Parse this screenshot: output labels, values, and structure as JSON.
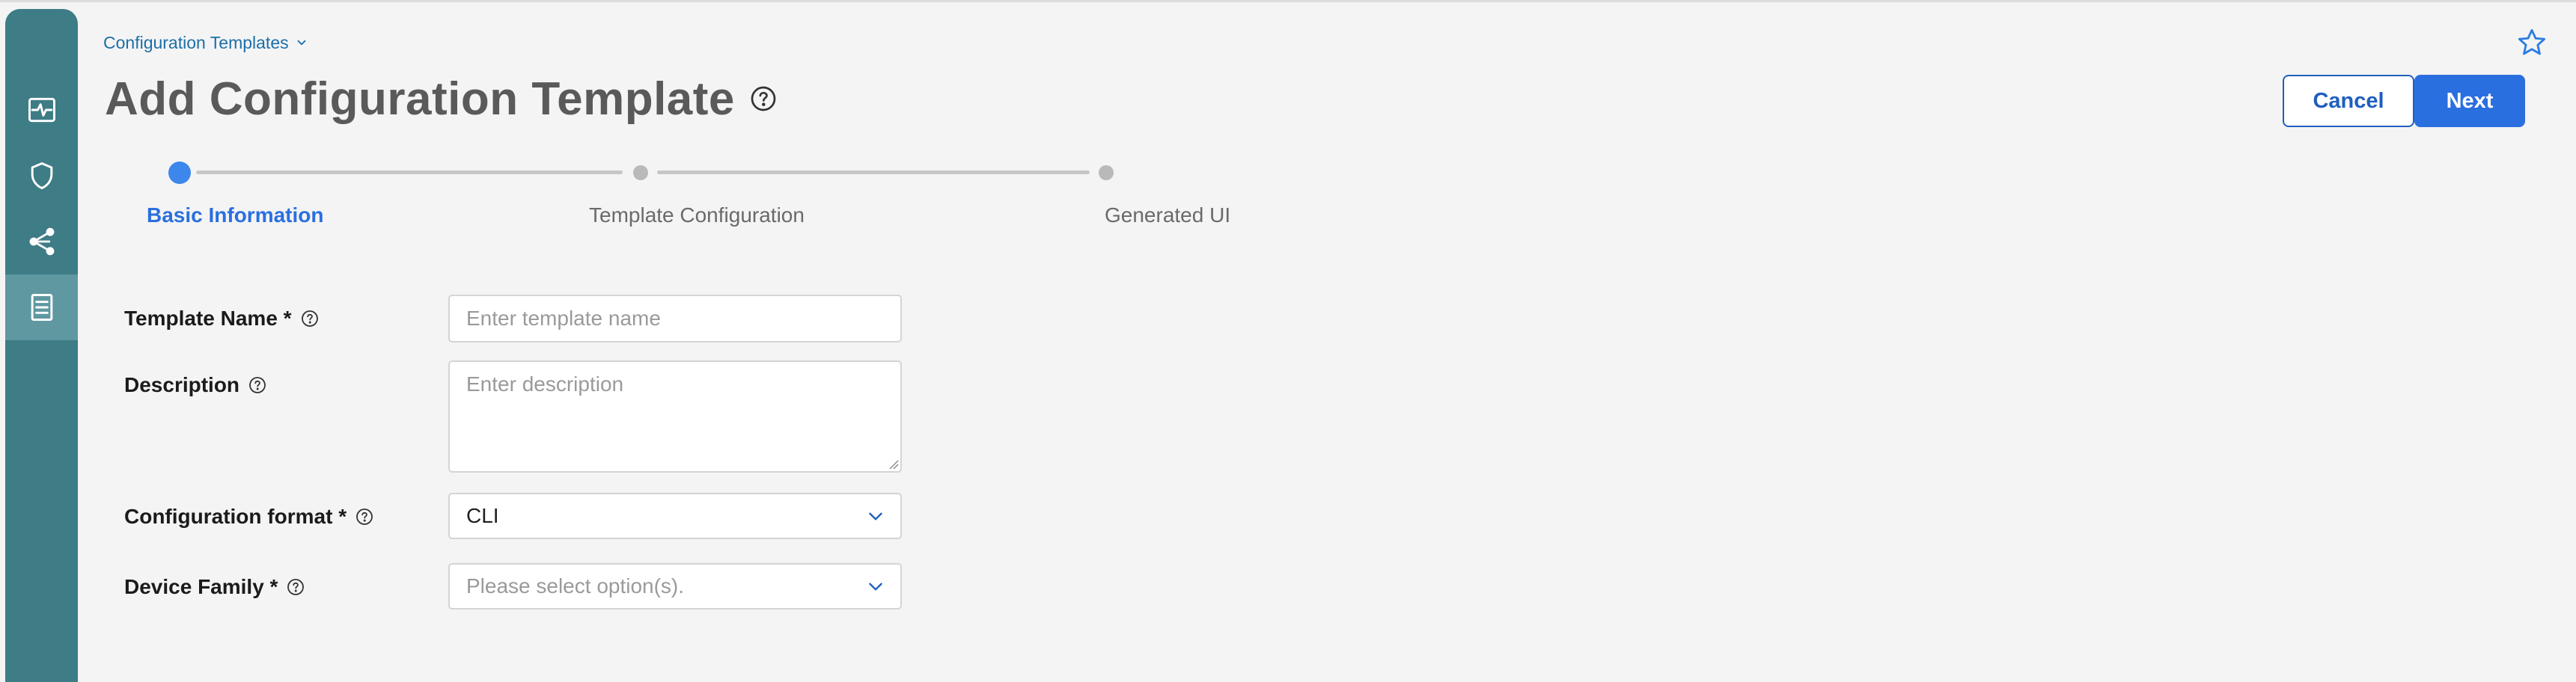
{
  "sidebar": {
    "items": [
      {
        "icon": "activity-monitor-icon",
        "active": false
      },
      {
        "icon": "shield-icon",
        "active": false
      },
      {
        "icon": "share-network-icon",
        "active": false
      },
      {
        "icon": "document-list-icon",
        "active": true
      }
    ]
  },
  "header": {
    "breadcrumb": "Configuration Templates",
    "title": "Add Configuration Template",
    "cancel_label": "Cancel",
    "next_label": "Next"
  },
  "stepper": {
    "steps": [
      {
        "label": "Basic Information",
        "active": true
      },
      {
        "label": "Template Configuration",
        "active": false
      },
      {
        "label": "Generated UI",
        "active": false
      }
    ]
  },
  "form": {
    "template_name": {
      "label": "Template Name *",
      "placeholder": "Enter template name",
      "value": ""
    },
    "description": {
      "label": "Description",
      "placeholder": "Enter description",
      "value": ""
    },
    "configuration_format": {
      "label": "Configuration format *",
      "value": "CLI"
    },
    "device_family": {
      "label": "Device Family *",
      "placeholder": "Please select option(s).",
      "value": ""
    }
  },
  "colors": {
    "sidebar": "#3e7c86",
    "sidebar_active": "#5f98a1",
    "accent": "#2a6fdf",
    "link": "#1b6fa8"
  }
}
